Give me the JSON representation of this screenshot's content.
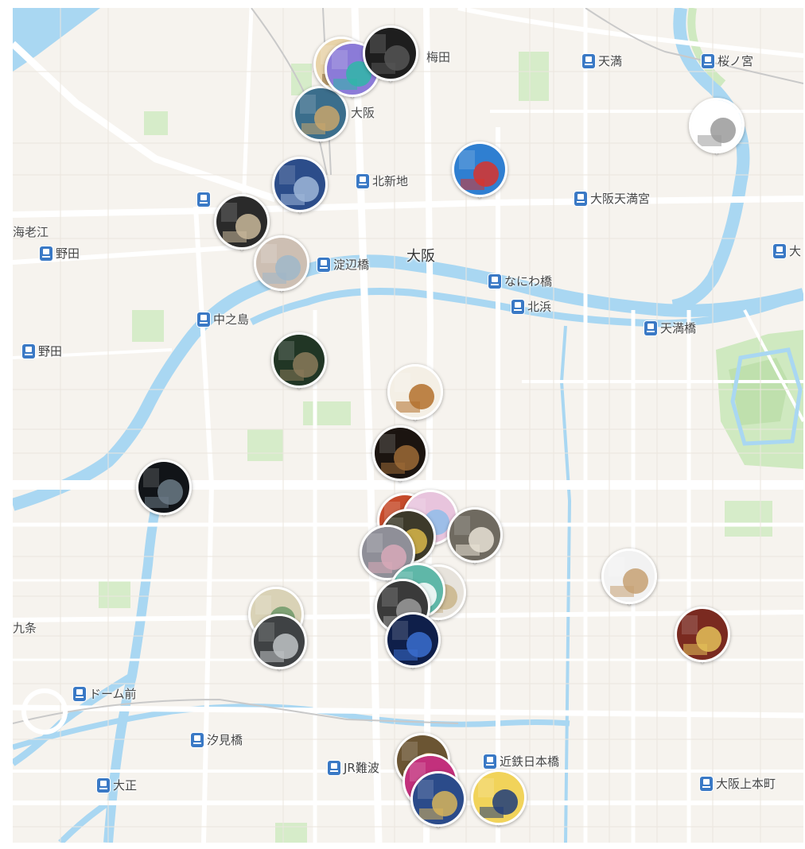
{
  "map": {
    "colors": {
      "land": "#f6f3ee",
      "water": "#a9d7f2",
      "park": "#cfe9c0",
      "road": "#ffffff",
      "station": "#3a79c5"
    },
    "labels": {
      "umeda": "梅田",
      "osaka_st": "大阪",
      "osaka_area": "大阪",
      "ebie": "海老江",
      "nakanoshima": "中之島",
      "kujo": "九条"
    },
    "stations": {
      "tenma": "天満",
      "sakuranomiya": "桜ノ宮",
      "kitashinchi": "北新地",
      "osaka_tenmangu": "大阪天満宮",
      "noda_1": "野田",
      "yodoyabashi": "淀辺橋",
      "naniwabashi": "なにわ橋",
      "kitahama": "北浜",
      "temmabashi": "天満橋",
      "noda_2": "野田",
      "dome_mae": "ドーム前",
      "shiomibashi": "汐見橋",
      "taisho": "大正",
      "jr_namba": "JR難波",
      "kintetsu_nipponbashi": "近鉄日本橋",
      "osaka_uehommachi": "大阪上本町",
      "dai_cut": "大"
    },
    "pins": [
      {
        "name": "pin-blue-sneaker-art",
        "colors": [
          "#3b6e8c",
          "#c9a66b"
        ],
        "icon": "photo"
      },
      {
        "name": "pin-ceramic-figure",
        "colors": [
          "#e8d3a8",
          "#8b6a3a"
        ],
        "icon": "photo"
      },
      {
        "name": "pin-colorful-installation",
        "colors": [
          "#8b7bd8",
          "#2fb7a8"
        ],
        "icon": "photo"
      },
      {
        "name": "pin-dark-art-top",
        "colors": [
          "#1e1e1e",
          "#555555"
        ],
        "icon": "photo"
      },
      {
        "name": "pin-glass-building",
        "colors": [
          "#2c4d8a",
          "#9fb7d8"
        ],
        "icon": "photo"
      },
      {
        "name": "pin-chair-sculpture",
        "colors": [
          "#2a2a2a",
          "#c9b89a"
        ],
        "icon": "photo"
      },
      {
        "name": "pin-abstract-texture",
        "colors": [
          "#cdbfb3",
          "#9fb7c9"
        ],
        "icon": "photo"
      },
      {
        "name": "pin-comic-art",
        "colors": [
          "#2f7fd1",
          "#d9332c"
        ],
        "icon": "photo"
      },
      {
        "name": "pin-line-drawing",
        "colors": [
          "#ffffff",
          "#9a9a9a"
        ],
        "icon": "photo"
      },
      {
        "name": "pin-forest-sculpture",
        "colors": [
          "#213625",
          "#8a7a5a"
        ],
        "icon": "photo"
      },
      {
        "name": "pin-wooden-object",
        "colors": [
          "#f4efe5",
          "#b3702b"
        ],
        "icon": "photo"
      },
      {
        "name": "pin-bronze-bowl",
        "colors": [
          "#1b1410",
          "#9c6a36"
        ],
        "icon": "photo"
      },
      {
        "name": "pin-dark-gallery-room",
        "colors": [
          "#111418",
          "#6b7a86"
        ],
        "icon": "photo"
      },
      {
        "name": "pin-red-artwork",
        "colors": [
          "#c64a2a",
          "#f3d7b8"
        ],
        "icon": "photo"
      },
      {
        "name": "pin-pink-illustration",
        "colors": [
          "#e8c4dd",
          "#8fbdea"
        ],
        "icon": "photo"
      },
      {
        "name": "pin-yellow-abstract",
        "colors": [
          "#3d3a2a",
          "#d9b84a"
        ],
        "icon": "photo"
      },
      {
        "name": "pin-pottery",
        "colors": [
          "#6f6a60",
          "#e9e2d6"
        ],
        "icon": "photo"
      },
      {
        "name": "pin-marble-figure",
        "colors": [
          "#8f8f98",
          "#d8a9b8"
        ],
        "icon": "photo"
      },
      {
        "name": "pin-floral-pattern",
        "colors": [
          "#e7e3dc",
          "#c9b58a"
        ],
        "icon": "photo"
      },
      {
        "name": "pin-teal-art",
        "colors": [
          "#5fb7a8",
          "#ffffff"
        ],
        "icon": "photo"
      },
      {
        "name": "pin-grey-room",
        "colors": [
          "#3a3a3a",
          "#9b9b9b"
        ],
        "icon": "photo"
      },
      {
        "name": "pin-blue-exhibition",
        "colors": [
          "#0f1f4a",
          "#3a6ecf"
        ],
        "icon": "photo"
      },
      {
        "name": "pin-teacup",
        "colors": [
          "#f2f2f2",
          "#c7a173"
        ],
        "icon": "photo"
      },
      {
        "name": "pin-red-interior",
        "colors": [
          "#7a2a20",
          "#e4c15a"
        ],
        "icon": "photo"
      },
      {
        "name": "pin-botanical-print",
        "colors": [
          "#d9d2b6",
          "#6f9a6a"
        ],
        "icon": "photo"
      },
      {
        "name": "pin-museum-hall",
        "colors": [
          "#3f4244",
          "#bfc3c5"
        ],
        "icon": "photo"
      },
      {
        "name": "pin-gold-frame",
        "colors": [
          "#6b5533",
          "#d8b06a"
        ],
        "icon": "photo"
      },
      {
        "name": "pin-pink-costume",
        "colors": [
          "#c2307c",
          "#f3a9cf"
        ],
        "icon": "photo"
      },
      {
        "name": "pin-bookshelf",
        "colors": [
          "#2b4b8a",
          "#d8b55a"
        ],
        "icon": "photo"
      },
      {
        "name": "pin-kimono-print",
        "colors": [
          "#f1d35a",
          "#1f3c7a"
        ],
        "icon": "photo"
      }
    ]
  }
}
